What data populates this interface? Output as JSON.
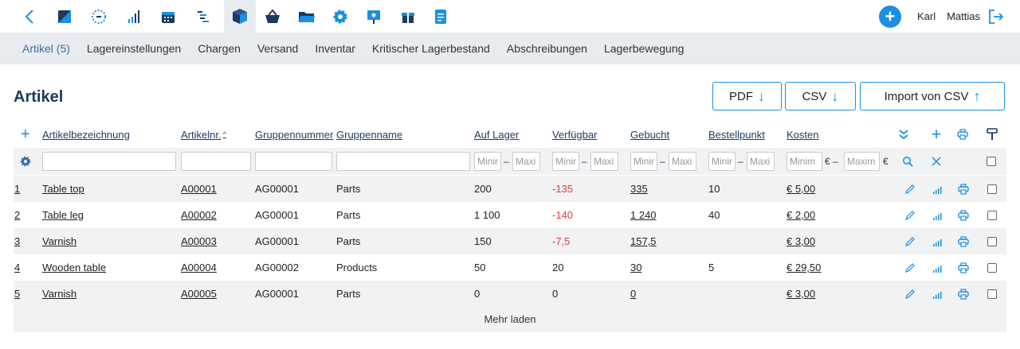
{
  "user": {
    "first_name": "Karl",
    "last_name": "Mattias"
  },
  "nav": {
    "tabs": [
      {
        "label": "Artikel (5)",
        "active": true
      },
      {
        "label": "Lagereinstellungen"
      },
      {
        "label": "Chargen"
      },
      {
        "label": "Versand"
      },
      {
        "label": "Inventar"
      },
      {
        "label": "Kritischer Lagerbestand"
      },
      {
        "label": "Abschreibungen"
      },
      {
        "label": "Lagerbewegung"
      }
    ]
  },
  "page": {
    "title": "Artikel"
  },
  "export": {
    "pdf": "PDF",
    "csv": "CSV",
    "import_csv": "Import von CSV"
  },
  "table": {
    "columns": {
      "name": "Artikelbezeichnung",
      "number": "Artikelnr.",
      "number_sort": "^",
      "group_no": "Gruppennummer",
      "group_name": "Gruppenname",
      "stock": "Auf Lager",
      "available": "Verfügbar",
      "booked": "Gebucht",
      "reorder": "Bestellpunkt",
      "cost": "Kosten"
    },
    "filter": {
      "min": "Minir",
      "max": "Maxi",
      "cost_min": "Minim",
      "cost_max": "Maxim",
      "dash": "–",
      "currency_dash": "€ –",
      "currency": "€"
    },
    "rows": [
      {
        "idx": "1",
        "name": "Table top",
        "number": "A00001",
        "group_no": "AG00001",
        "group_name": "Parts",
        "stock": "200",
        "available": "-135",
        "available_negative": true,
        "booked": "335",
        "reorder": "10",
        "cost": "€ 5,00"
      },
      {
        "idx": "2",
        "name": "Table leg",
        "number": "A00002",
        "group_no": "AG00001",
        "group_name": "Parts",
        "stock": "1 100",
        "available": "-140",
        "available_negative": true,
        "booked": "1 240",
        "reorder": "40",
        "cost": "€ 2,00"
      },
      {
        "idx": "3",
        "name": "Varnish",
        "number": "A00003",
        "group_no": "AG00001",
        "group_name": "Parts",
        "stock": "150",
        "available": "-7,5",
        "available_negative": true,
        "booked": "157,5",
        "reorder": "",
        "cost": "€ 3,00"
      },
      {
        "idx": "4",
        "name": "Wooden table",
        "number": "A00004",
        "group_no": "AG00002",
        "group_name": "Products",
        "stock": "50",
        "available": "20",
        "available_negative": false,
        "booked": "30",
        "reorder": "5",
        "cost": "€ 29,50"
      },
      {
        "idx": "5",
        "name": "Varnish",
        "number": "A00005",
        "group_no": "AG00001",
        "group_name": "Parts",
        "stock": "0",
        "available": "0",
        "available_negative": false,
        "booked": "0",
        "reorder": "",
        "cost": "€ 3,00"
      }
    ],
    "load_more": "Mehr laden"
  },
  "colors": {
    "accent": "#1a8fe3",
    "title": "#1c3a5e",
    "negative": "#e03c3c",
    "nav_bg": "#e8ecf0",
    "row_alt": "#f0f2f4"
  },
  "icons": [
    "back-chevron-icon",
    "dashboard-icon",
    "loading-icon",
    "bar-chart-icon",
    "calendar-icon",
    "gantt-icon",
    "warehouse-box-icon",
    "basket-icon",
    "folder-icon",
    "gear-icon",
    "presentation-icon",
    "gift-icon",
    "document-icon",
    "add-circle-icon",
    "logout-icon"
  ]
}
